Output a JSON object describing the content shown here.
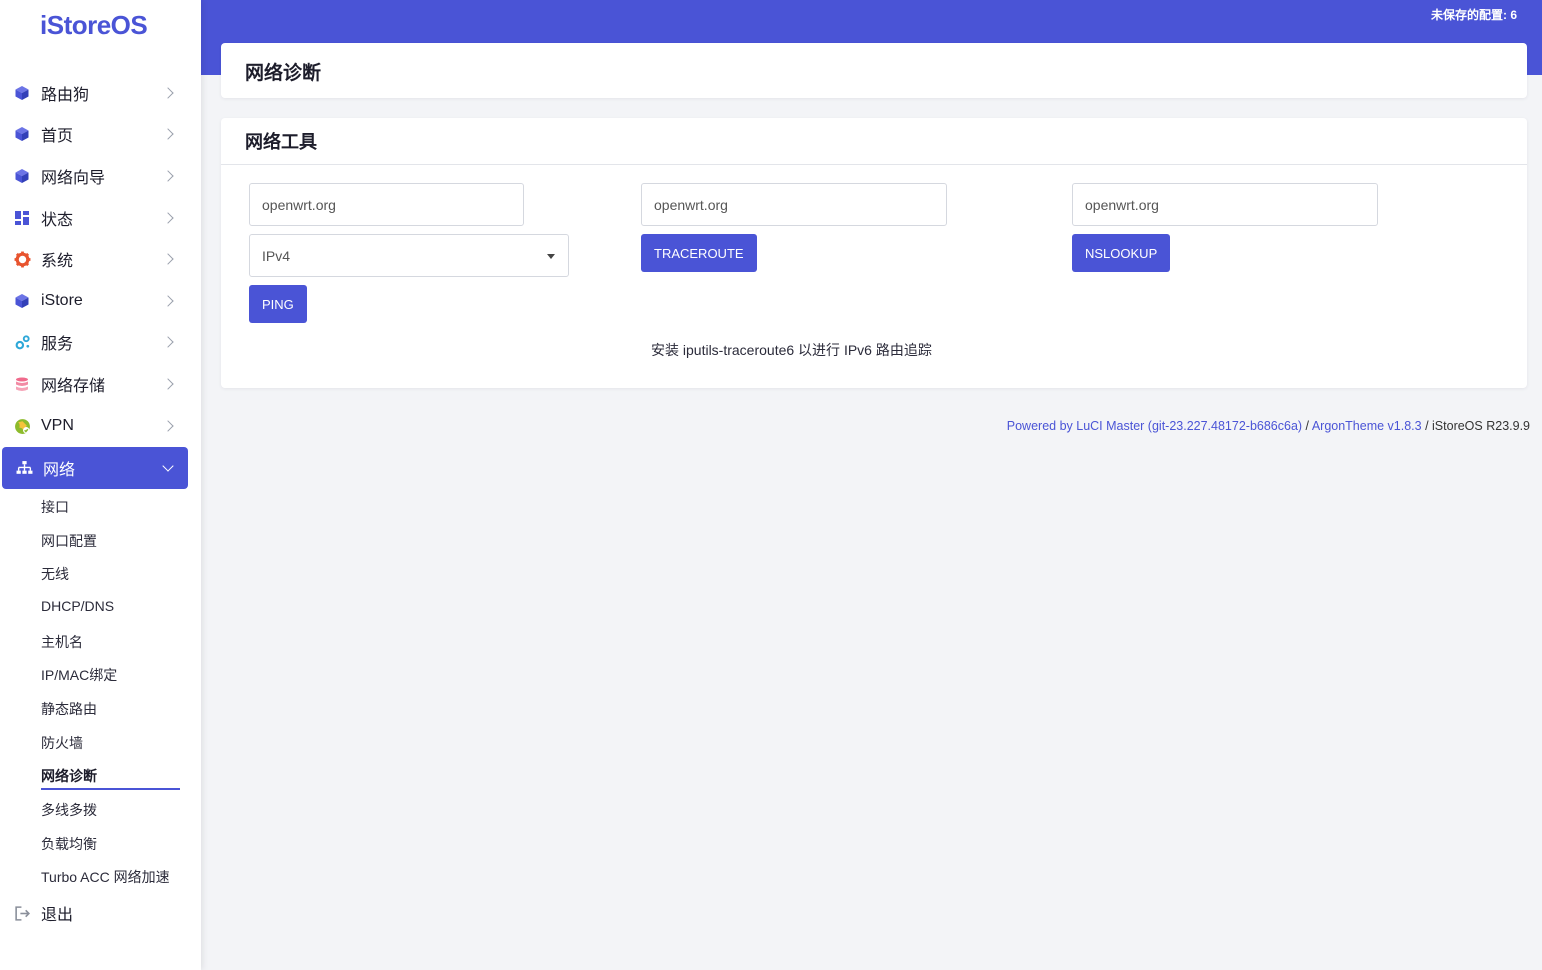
{
  "brand": {
    "logo": "iStoreOS"
  },
  "header": {
    "unsaved_label": "未保存的配置: 6"
  },
  "sidebar": {
    "items": [
      {
        "label": "路由狗",
        "icon": "cube-icon"
      },
      {
        "label": "首页",
        "icon": "cube-icon"
      },
      {
        "label": "网络向导",
        "icon": "cube-icon"
      },
      {
        "label": "状态",
        "icon": "dashboard-icon"
      },
      {
        "label": "系统",
        "icon": "gear-icon"
      },
      {
        "label": "iStore",
        "icon": "cube-icon"
      },
      {
        "label": "服务",
        "icon": "cogs-icon"
      },
      {
        "label": "网络存储",
        "icon": "database-icon"
      },
      {
        "label": "VPN",
        "icon": "globe-icon"
      },
      {
        "label": "网络",
        "icon": "network-icon",
        "active": true
      }
    ],
    "subitems": [
      "接口",
      "网口配置",
      "无线",
      "DHCP/DNS",
      "主机名",
      "IP/MAC绑定",
      "静态路由",
      "防火墙",
      "网络诊断",
      "多线多拨",
      "负载均衡",
      "Turbo ACC 网络加速"
    ],
    "logout": {
      "label": "退出",
      "icon": "logout-icon"
    }
  },
  "main": {
    "page_title": "网络诊断",
    "tools_title": "网络工具",
    "ping": {
      "host_value": "openwrt.org",
      "protocol_selected": "IPv4",
      "button": "PING"
    },
    "traceroute": {
      "host_value": "openwrt.org",
      "button": "TRACEROUTE"
    },
    "nslookup": {
      "host_value": "openwrt.org",
      "button": "NSLOOKUP"
    },
    "hint": "安装 iputils-traceroute6 以进行 IPv6 路由追踪"
  },
  "footer": {
    "luci": "Powered by LuCI Master (git-23.227.48172-b686c6a)",
    "sep1": " / ",
    "theme": "ArgonTheme v1.8.3",
    "sep2": " / ",
    "os": "iStoreOS R23.9.9"
  },
  "colors": {
    "accent": "#4a54d6",
    "background": "#f3f4f7"
  }
}
